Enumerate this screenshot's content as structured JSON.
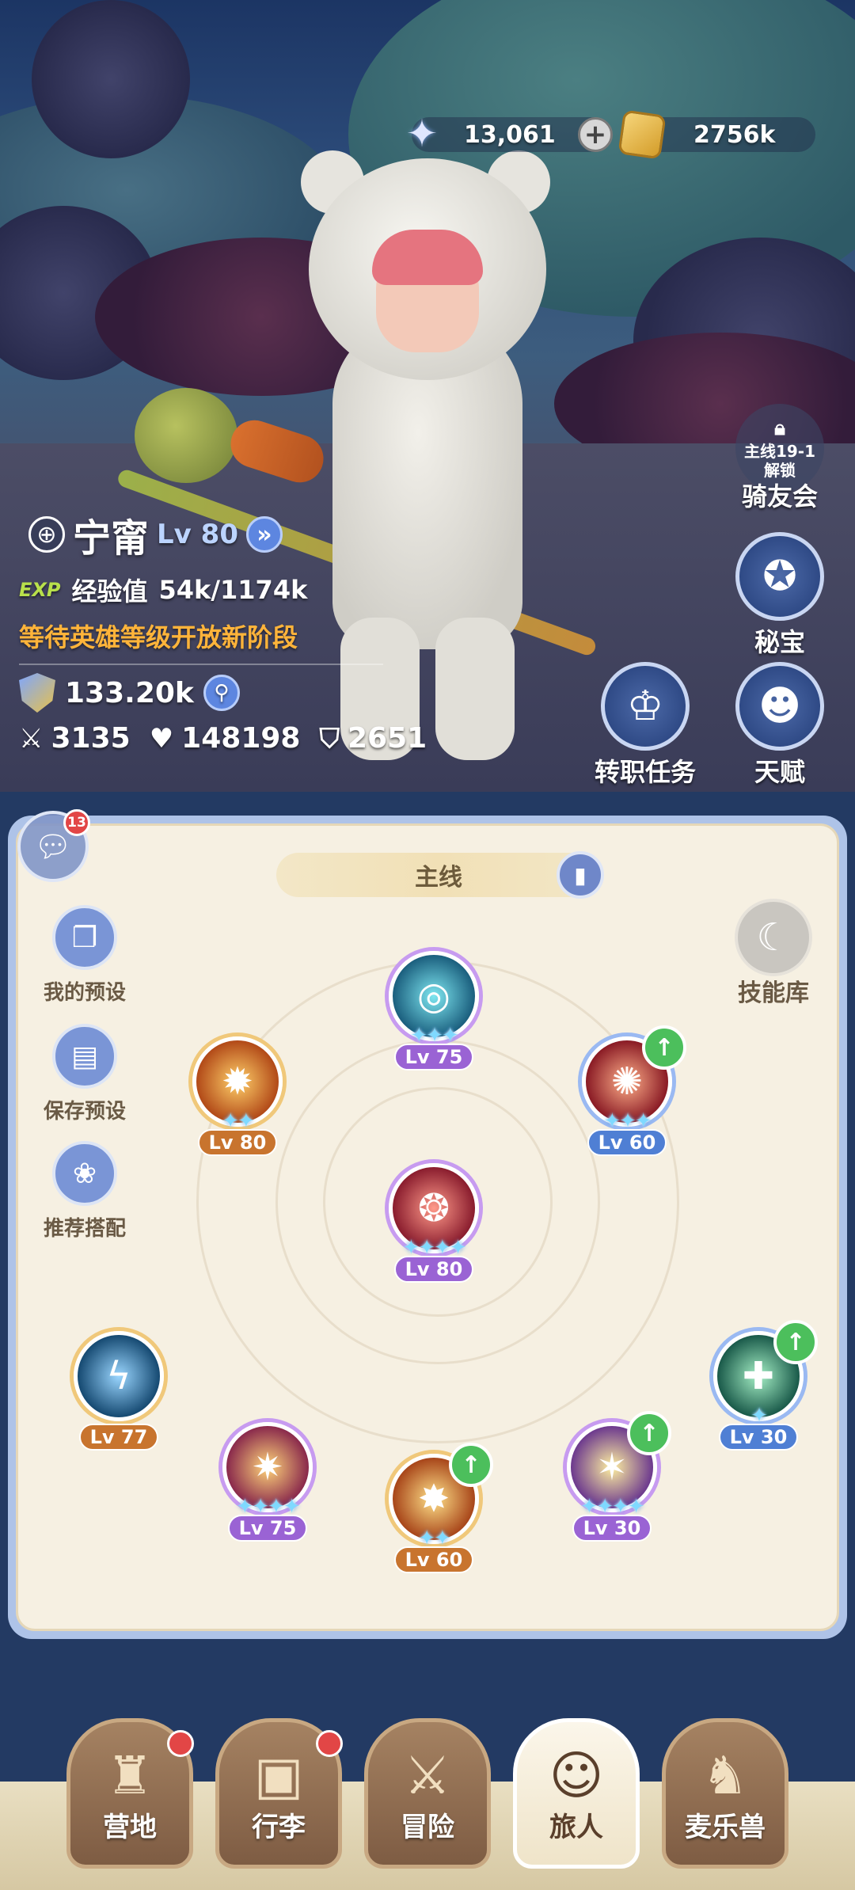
{
  "currency": {
    "gems": "13,061",
    "gold": "2756k"
  },
  "hero": {
    "name": "宁甯",
    "level": "Lv 80",
    "exp_tag": "EXP",
    "exp_label": "经验值",
    "exp_value": "54k/1174k",
    "notice": "等待英雄等级开放新阶段",
    "power": "133.20k",
    "attack": "3135",
    "hp": "148198",
    "defense": "2651"
  },
  "side": {
    "lock_line1": "主线19-1",
    "lock_line2": "解锁",
    "club_label": "骑友会",
    "treasure_label": "秘宝",
    "job_label": "转职任务",
    "talent_label": "天赋"
  },
  "chat": {
    "badge": "13"
  },
  "panel": {
    "tab_title": "主线",
    "my_preset": "我的预设",
    "save_preset": "保存预设",
    "recommend": "推荐搭配",
    "skill_lib": "技能库",
    "skills": [
      {
        "level": "Lv 75",
        "stars": "✦✦✦"
      },
      {
        "level": "Lv 80",
        "stars": "✦✦"
      },
      {
        "level": "Lv 60",
        "stars": "✦✦✦"
      },
      {
        "level": "Lv 80",
        "stars": "✦✦✦✦"
      },
      {
        "level": "Lv 77",
        "stars": ""
      },
      {
        "level": "Lv 75",
        "stars": "✦✦✦✦"
      },
      {
        "level": "Lv 60",
        "stars": "✦✦"
      },
      {
        "level": "Lv 30",
        "stars": "✦✦✦✦"
      },
      {
        "level": "Lv 30",
        "stars": "✦"
      }
    ]
  },
  "nav": {
    "camp": "营地",
    "luggage": "行李",
    "adventure": "冒险",
    "traveler": "旅人",
    "beast": "麦乐兽"
  }
}
